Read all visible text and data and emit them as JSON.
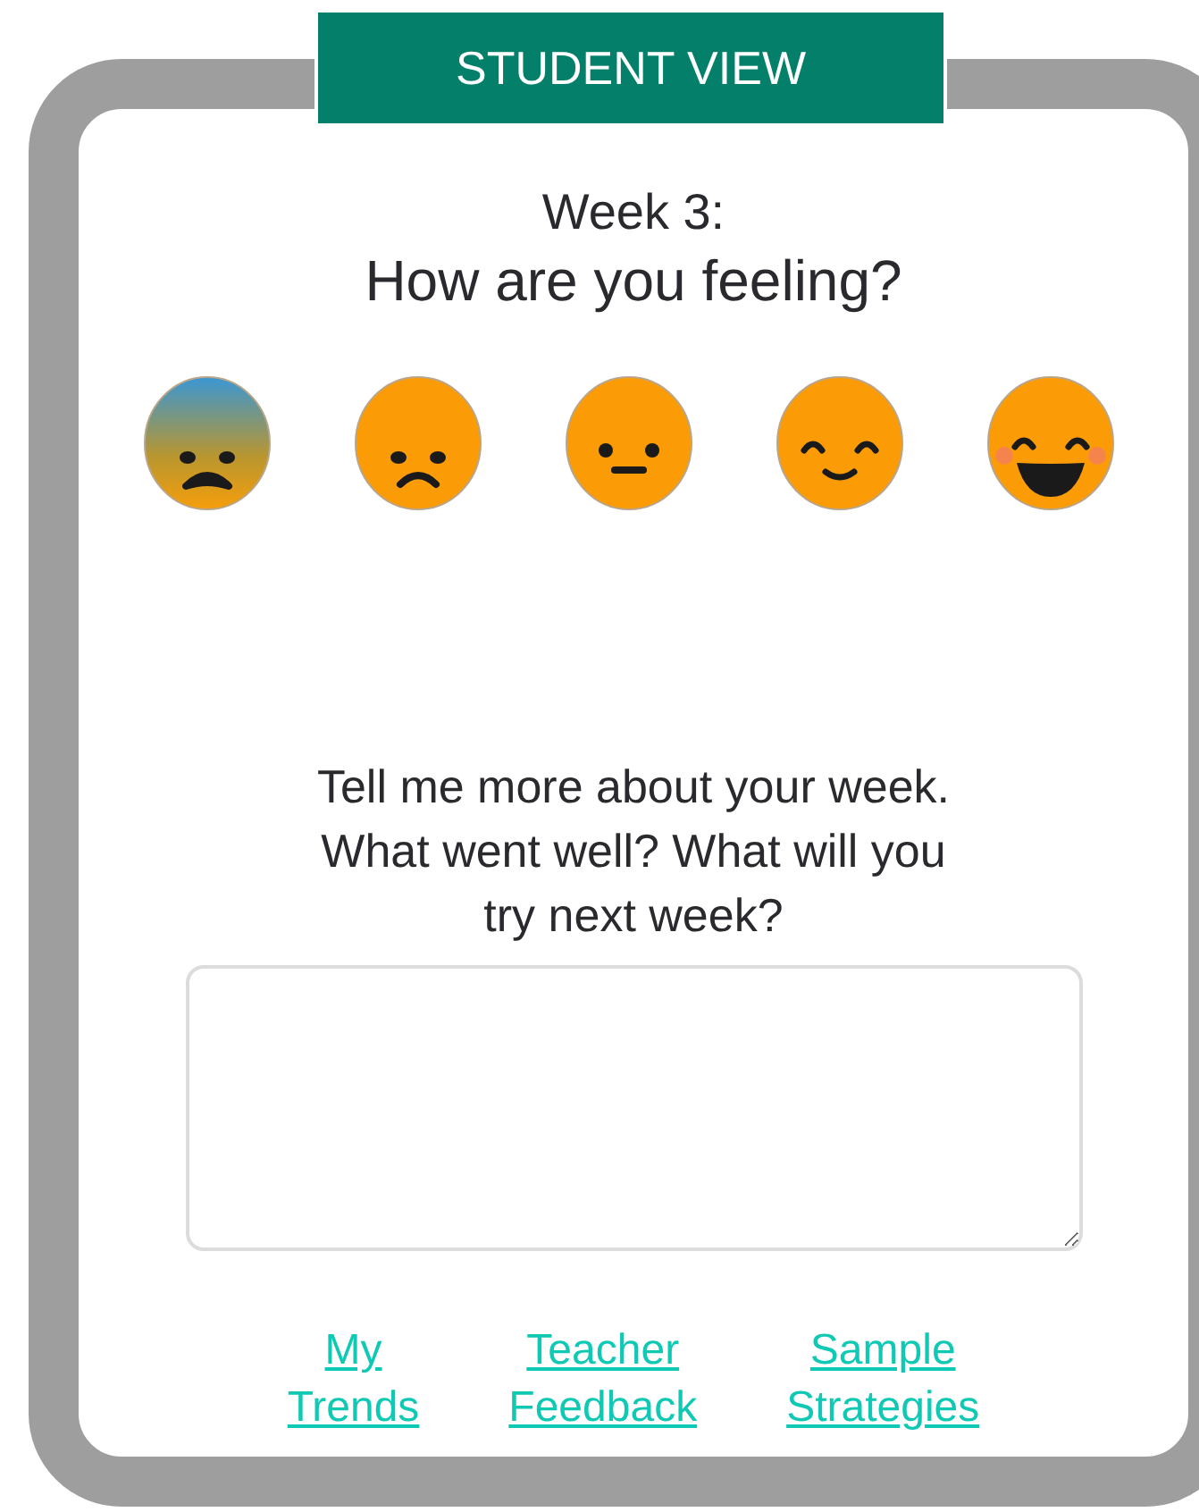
{
  "header": {
    "title": "STUDENT VIEW"
  },
  "heading": {
    "week": "Week 3:",
    "question": "How are you feeling?"
  },
  "faces": [
    {
      "kind": "worried"
    },
    {
      "kind": "sad"
    },
    {
      "kind": "neutral"
    },
    {
      "kind": "smile"
    },
    {
      "kind": "grin"
    }
  ],
  "reflection": {
    "prompt": "Tell me more about your week. What went well? What will you try next week?"
  },
  "links": [
    {
      "lines": [
        "My",
        "Trends"
      ]
    },
    {
      "lines": [
        "Teacher",
        "Feedback"
      ]
    },
    {
      "lines": [
        "Sample",
        "Strategies"
      ]
    }
  ]
}
